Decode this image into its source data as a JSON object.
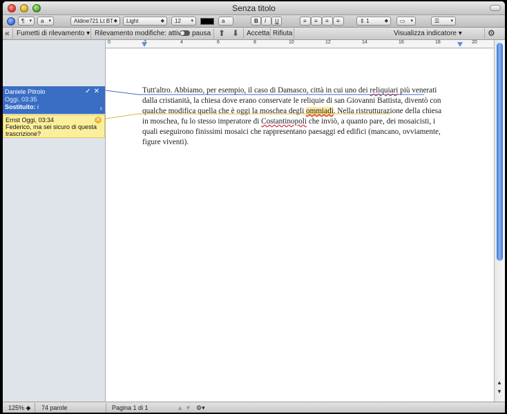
{
  "window": {
    "title": "Senza titolo"
  },
  "format_toolbar": {
    "style_selector": "¶",
    "char_style_selector": "a",
    "font_family": "Aldine721 Lt BT",
    "font_weight": "Light",
    "font_size": "12",
    "highlight_label": "a",
    "bold": "B",
    "italic": "I",
    "underline": "U",
    "line_spacing": "1",
    "text_color": "#000000"
  },
  "tracking_bar": {
    "balloons_menu": "Fumetti di rilevamento ▾",
    "track_changes_label": "Rilevamento modifiche: attivo",
    "pause_label": "pausa",
    "accept": "Accetta",
    "reject": "Rifiuta",
    "show_markup_menu": "Visualizza indicatore ▾"
  },
  "ruler": {
    "labels": [
      "0",
      "2",
      "4",
      "6",
      "8",
      "10",
      "12",
      "14",
      "16",
      "18",
      "20"
    ]
  },
  "sidebar": {
    "change_balloon": {
      "author": "Daniele Pitrolo",
      "time": "Oggi, 03:35",
      "change_label": "Sostituito:",
      "change_value": "i"
    },
    "comment_balloon": {
      "author_time": "Ernst Oggi, 03:34",
      "text": "Federico, ma sei sicuro di questa trascrizione?"
    }
  },
  "document": {
    "p1": "Tutt'altro. Abbiamo, per esempio, il caso di Damasco, città in cui uno dei ",
    "w_reliquiari": "reliquiari",
    "p2": " più venerati dalla cristianità, la chiesa dove erano conservate le reliquie di san Giovanni Battista, diventò con qualche modifica quella che è oggi la moschea degli ",
    "w_ommiadi": "ommiadi",
    "p3": ". Nella ristrutturazione della chiesa in moschea, fu lo stesso imperatore di ",
    "w_costantinopoli": "Costantinopoli",
    "p4": " che inviò, a quanto pare, dei mosaicisti, i quali eseguirono finissimi mosaici che rappresentano paesaggi ed edifici (mancano, ovviamente, figure viventi)."
  },
  "status_bar": {
    "zoom": "125%",
    "word_count": "74 parole",
    "page_info": "Pagina 1 di 1"
  },
  "colors": {
    "change_balloon_bg": "#3a6ec4",
    "comment_balloon_bg": "#fbef9b",
    "scroll_thumb": "#3c79d8",
    "spell_error": "#dd2233"
  },
  "icons": [
    "close-button",
    "minimize-button",
    "zoom-button",
    "toolbar-pill",
    "navigation-icon",
    "back-chevrons-icon",
    "previous-change-icon",
    "next-change-icon",
    "gear-icon",
    "accept-check-icon",
    "reject-x-icon",
    "expand-chevron-icon",
    "comment-close-icon",
    "scroll-up-icon",
    "scroll-down-icon",
    "page-prev-icon",
    "page-next-icon"
  ]
}
